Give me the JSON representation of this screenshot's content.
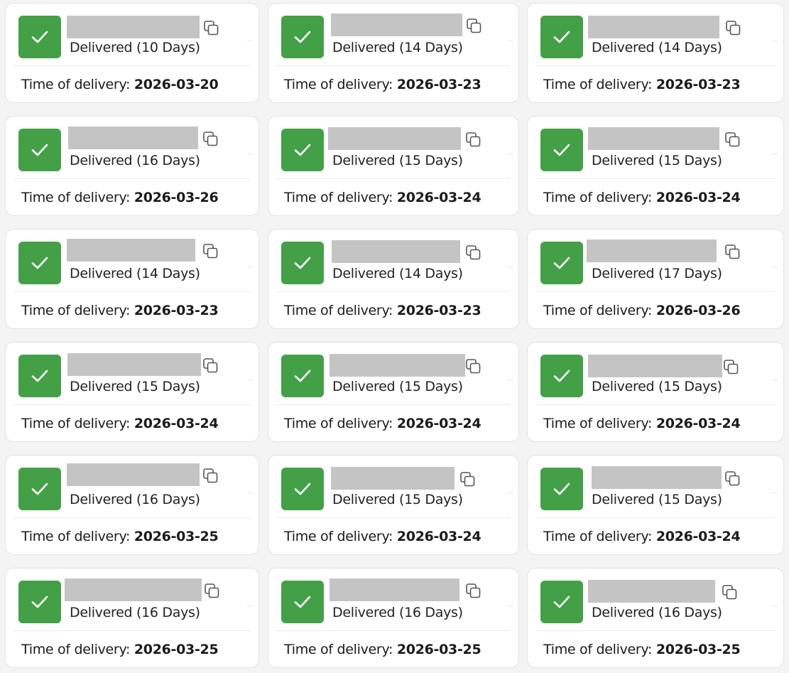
{
  "colors": {
    "success": "#43a047",
    "redaction": "#c4c4c4",
    "card_border": "#e2e2e2"
  },
  "icons": {
    "status": "check-icon",
    "copy": "copy-icon"
  },
  "time_label": "Time of delivery:",
  "cards": [
    {
      "status": "Delivered (10 Days)",
      "date": "2026-03-20"
    },
    {
      "status": "Delivered (14 Days)",
      "date": "2026-03-23"
    },
    {
      "status": "Delivered (14 Days)",
      "date": "2026-03-23"
    },
    {
      "status": "Delivered (16 Days)",
      "date": "2026-03-26"
    },
    {
      "status": "Delivered (15 Days)",
      "date": "2026-03-24"
    },
    {
      "status": "Delivered (15 Days)",
      "date": "2026-03-24"
    },
    {
      "status": "Delivered (14 Days)",
      "date": "2026-03-23"
    },
    {
      "status": "Delivered (14 Days)",
      "date": "2026-03-23"
    },
    {
      "status": "Delivered (17 Days)",
      "date": "2026-03-26"
    },
    {
      "status": "Delivered (15 Days)",
      "date": "2026-03-24"
    },
    {
      "status": "Delivered (15 Days)",
      "date": "2026-03-24"
    },
    {
      "status": "Delivered (15 Days)",
      "date": "2026-03-24"
    },
    {
      "status": "Delivered (16 Days)",
      "date": "2026-03-25"
    },
    {
      "status": "Delivered (15 Days)",
      "date": "2026-03-24"
    },
    {
      "status": "Delivered (15 Days)",
      "date": "2026-03-24"
    },
    {
      "status": "Delivered (16 Days)",
      "date": "2026-03-25"
    },
    {
      "status": "Delivered (16 Days)",
      "date": "2026-03-25"
    },
    {
      "status": "Delivered (16 Days)",
      "date": "2026-03-25"
    }
  ]
}
